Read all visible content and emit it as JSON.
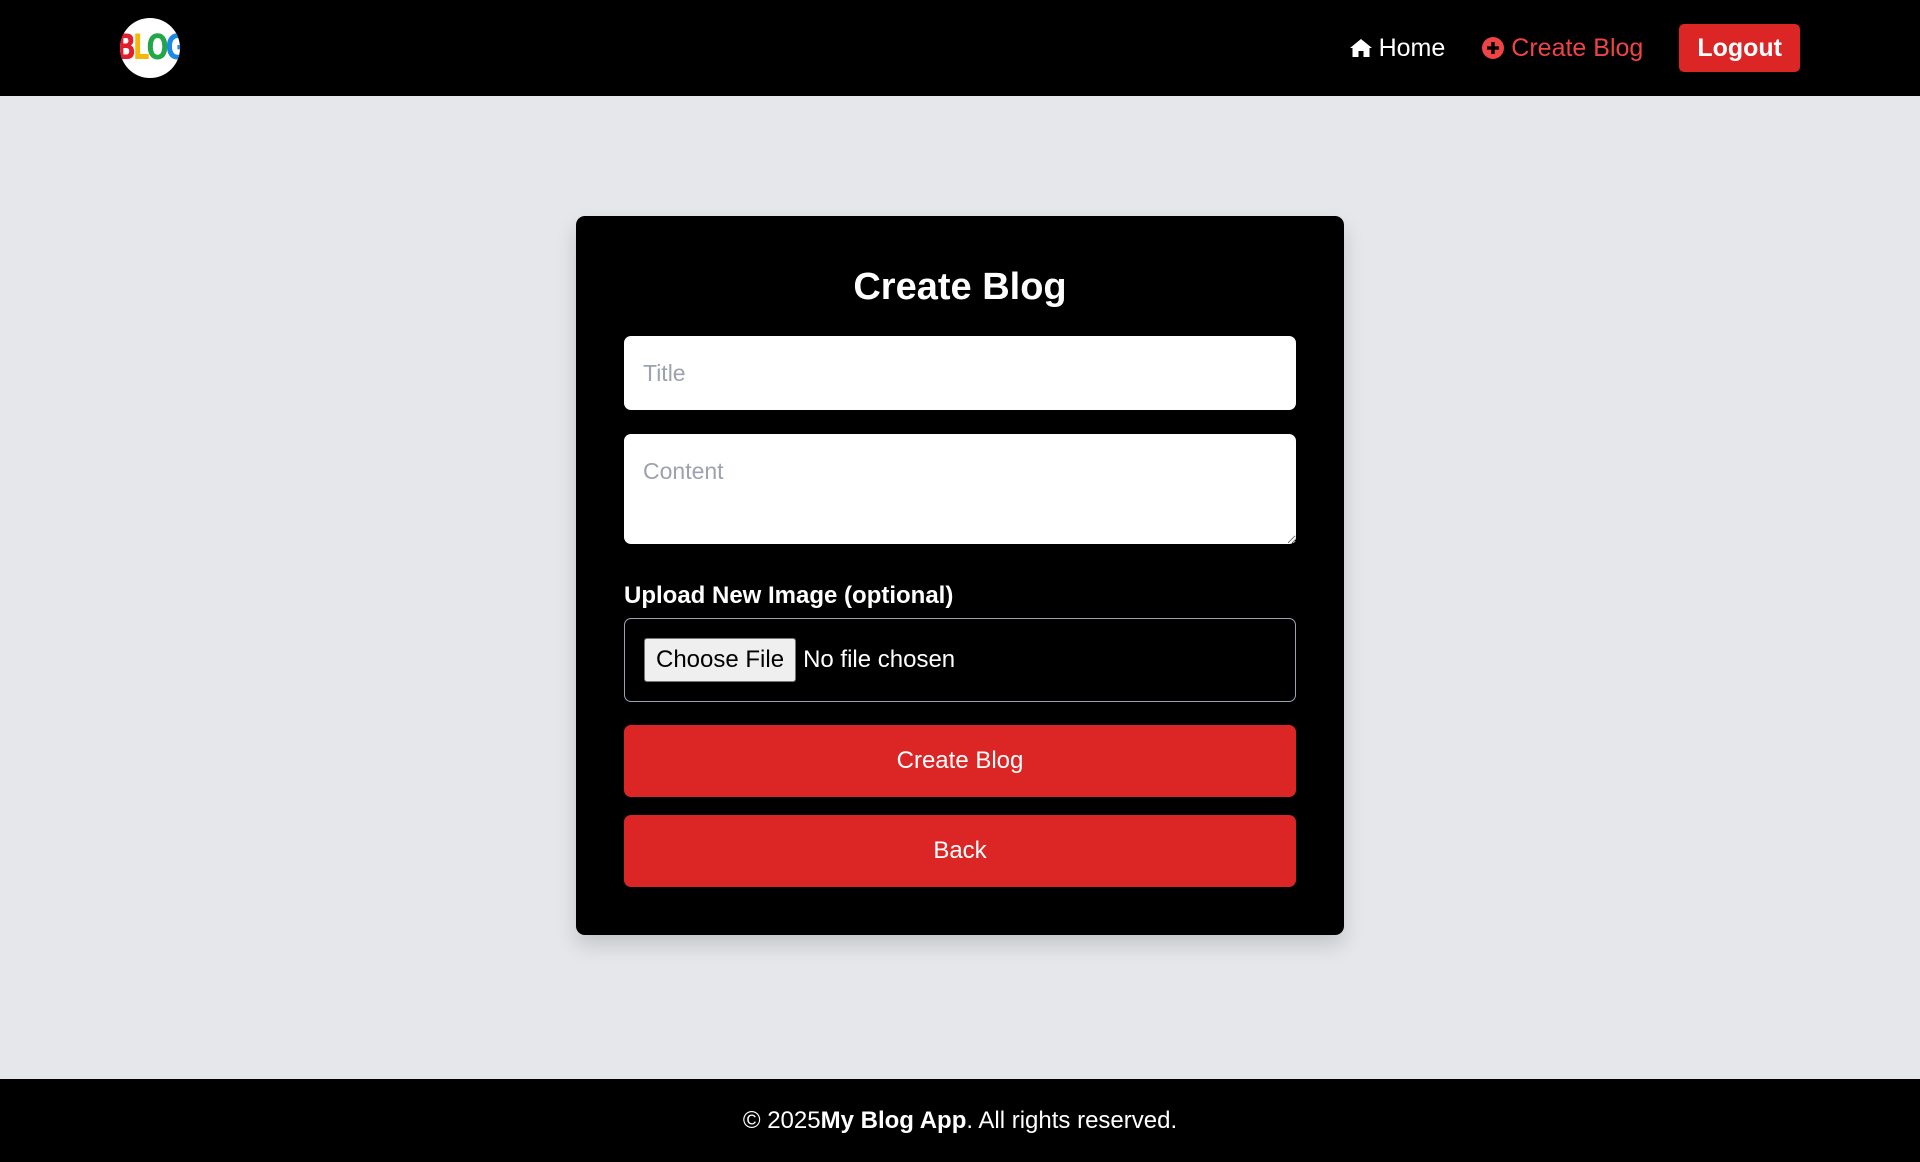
{
  "nav": {
    "logo_letters": [
      "B",
      "L",
      "O",
      "G"
    ],
    "logo_colors": [
      "#e11d2e",
      "#f5b70a",
      "#22a648",
      "#1e88e5"
    ],
    "home_label": "Home",
    "create_label": "Create Blog",
    "logout_label": "Logout",
    "home_icon": "home-icon",
    "create_icon": "plus-circle-icon"
  },
  "form": {
    "heading": "Create Blog",
    "title_placeholder": "Title",
    "content_placeholder": "Content",
    "upload_label": "Upload New Image (optional)",
    "choose_file_label": "Choose File",
    "no_file_text": "No file chosen",
    "submit_label": "Create Blog",
    "back_label": "Back"
  },
  "footer": {
    "prefix": "© 2025 ",
    "app_name": "My Blog App",
    "suffix": ". All rights reserved."
  },
  "colors": {
    "accent_red": "#dc2626",
    "page_bg": "#e5e7eb",
    "bar_bg": "#000000"
  }
}
